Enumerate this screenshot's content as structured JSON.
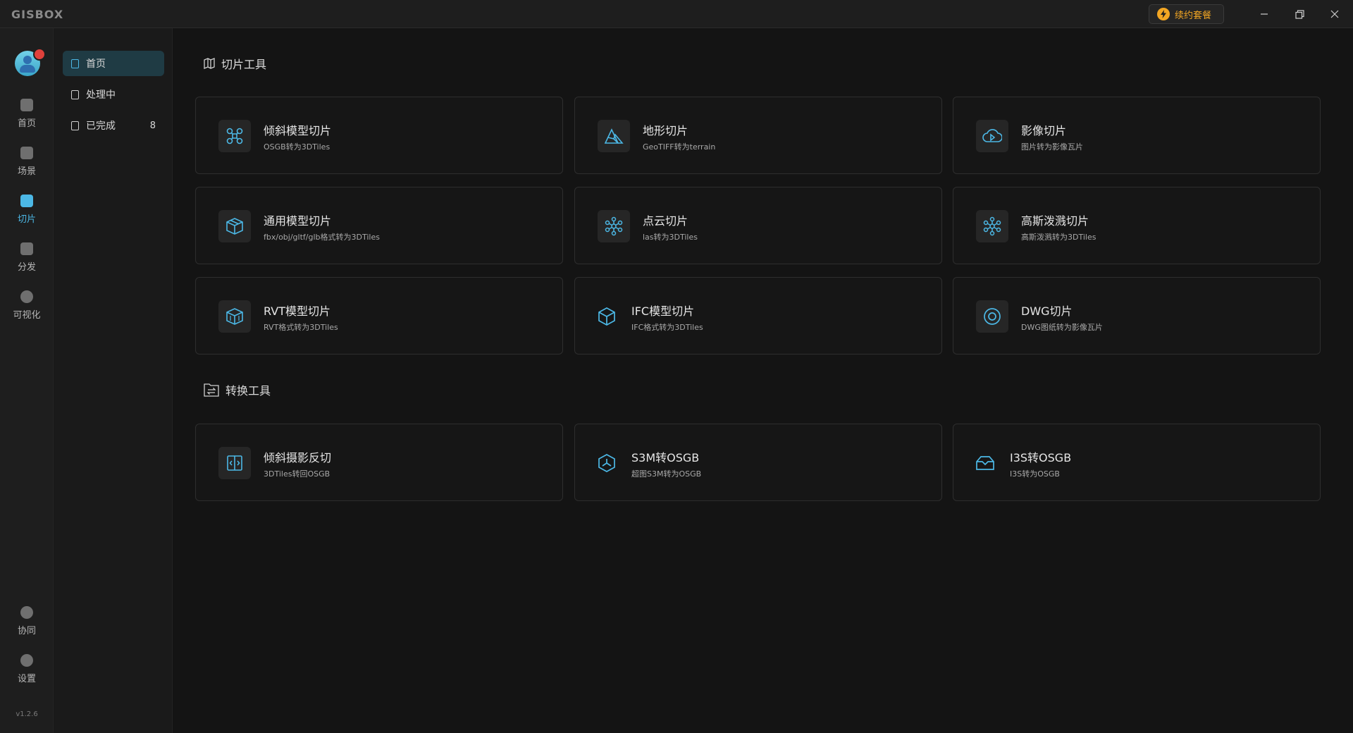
{
  "app": {
    "logo": "GISBOX"
  },
  "titlebar": {
    "renew_label": "续约套餐"
  },
  "rail": {
    "items": [
      {
        "label": "首页",
        "icon": "home-icon"
      },
      {
        "label": "场景",
        "icon": "scene-icon"
      },
      {
        "label": "切片",
        "icon": "slice-icon",
        "active": true
      },
      {
        "label": "分发",
        "icon": "distribute-icon"
      },
      {
        "label": "可视化",
        "icon": "visualize-icon"
      },
      {
        "label": "协同",
        "icon": "lock-icon"
      },
      {
        "label": "设置",
        "icon": "gear-icon"
      }
    ],
    "version": "v1.2.6"
  },
  "subnav": {
    "items": [
      {
        "label": "首页",
        "active": true
      },
      {
        "label": "处理中"
      },
      {
        "label": "已完成",
        "count": "8"
      }
    ]
  },
  "main": {
    "slice_section": {
      "title": "切片工具",
      "cards": [
        {
          "title": "倾斜模型切片",
          "subtitle": "OSGB转为3DTiles",
          "icon": "drone-icon"
        },
        {
          "title": "地形切片",
          "subtitle": "GeoTIFF转为terrain",
          "icon": "terrain-icon"
        },
        {
          "title": "影像切片",
          "subtitle": "图片转为影像瓦片",
          "icon": "cloud-play-icon"
        },
        {
          "title": "通用模型切片",
          "subtitle": "fbx/obj/gltf/glb格式转为3DTiles",
          "icon": "box-icon"
        },
        {
          "title": "点云切片",
          "subtitle": "las转为3DTiles",
          "icon": "point-cloud-icon"
        },
        {
          "title": "高斯泼溅切片",
          "subtitle": "高斯泼溅转为3DTiles",
          "icon": "gaussian-icon"
        },
        {
          "title": "RVT模型切片",
          "subtitle": "RVT格式转为3DTiles",
          "icon": "rvt-cube-icon"
        },
        {
          "title": "IFC模型切片",
          "subtitle": "IFC格式转为3DTiles",
          "icon": "ifc-cube-icon"
        },
        {
          "title": "DWG切片",
          "subtitle": "DWG图纸转为影像瓦片",
          "icon": "dwg-circle-icon"
        }
      ]
    },
    "convert_section": {
      "title": "转换工具",
      "cards": [
        {
          "title": "倾斜摄影反切",
          "subtitle": "3DTiles转回OSGB",
          "icon": "reverse-slice-icon"
        },
        {
          "title": "S3M转OSGB",
          "subtitle": "超图S3M转为OSGB",
          "icon": "s3m-hexagon-icon"
        },
        {
          "title": "I3S转OSGB",
          "subtitle": "I3S转为OSGB",
          "icon": "i3s-box-icon"
        }
      ]
    }
  },
  "colors": {
    "accent": "#4cb8e6",
    "gold": "#f2a623",
    "background": "#141414",
    "card_border": "#2e2e2e"
  }
}
